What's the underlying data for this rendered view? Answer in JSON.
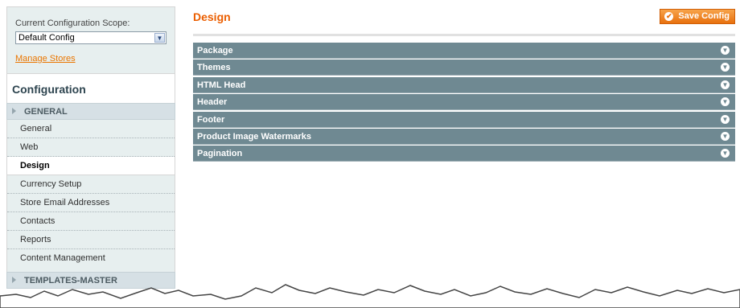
{
  "sidebar": {
    "scope_label": "Current Configuration Scope:",
    "scope_value": "Default Config",
    "manage_stores": "Manage Stores",
    "heading": "Configuration",
    "groups": [
      {
        "label": "GENERAL",
        "items": [
          "General",
          "Web",
          "Design",
          "Currency Setup",
          "Store Email Addresses",
          "Contacts",
          "Reports",
          "Content Management"
        ],
        "active": "Design"
      },
      {
        "label": "TEMPLATES-MASTER"
      }
    ]
  },
  "main": {
    "title": "Design",
    "save_label": "Save Config",
    "sections": [
      "Package",
      "Themes",
      "HTML Head",
      "Header",
      "Footer",
      "Product Image Watermarks",
      "Pagination"
    ]
  },
  "colors": {
    "accent": "#eb5e00",
    "section_bar": "#6f8992",
    "sidebar_bg": "#e7efef"
  }
}
